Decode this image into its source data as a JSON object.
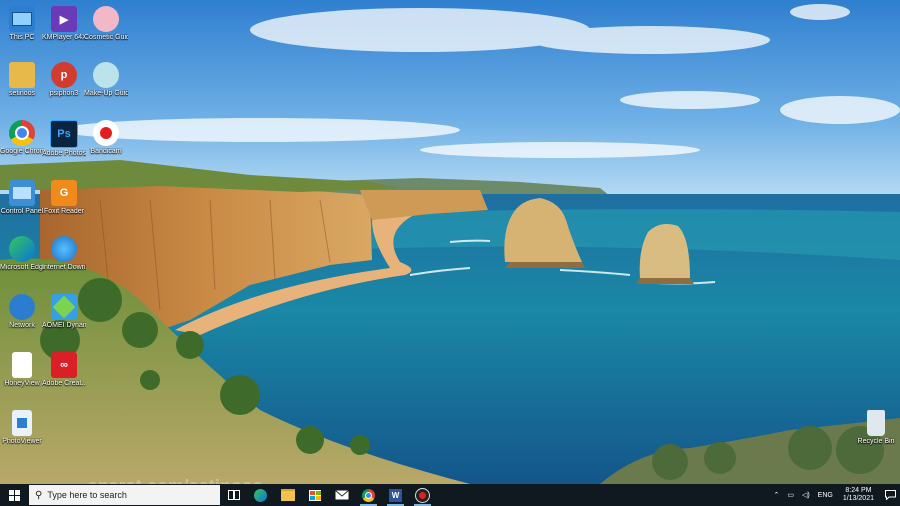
{
  "desktop": {
    "icons": [
      {
        "label": "This PC"
      },
      {
        "label": "KMPlayer 64X"
      },
      {
        "label": "Cosmetic Guide"
      },
      {
        "label": "setinoos"
      },
      {
        "label": "psiphon3"
      },
      {
        "label": "Make-Up Guide"
      },
      {
        "label": "Google Chrome"
      },
      {
        "label": "Adobe Photosh..."
      },
      {
        "label": "Bandicam"
      },
      {
        "label": "Control Panel"
      },
      {
        "label": "Foxit Reader"
      },
      {
        "label": "Microsoft Edge"
      },
      {
        "label": "Internet Downlo..."
      },
      {
        "label": "Network"
      },
      {
        "label": "AOMEI Dynamic D..."
      },
      {
        "label": "HoneyView"
      },
      {
        "label": "Adobe Creat..."
      },
      {
        "label": "PhotoViewer"
      },
      {
        "label": "Recycle Bin"
      }
    ]
  },
  "watermark": "aparat.com/setinoos",
  "taskbar": {
    "search_placeholder": "Type here to search",
    "pinned": [
      "task-view",
      "edge",
      "file-explorer",
      "microsoft-store",
      "mail",
      "chrome",
      "word",
      "bandicam"
    ],
    "tray": {
      "language": "ENG",
      "time": "8:24 PM",
      "date": "1/13/2021"
    }
  }
}
